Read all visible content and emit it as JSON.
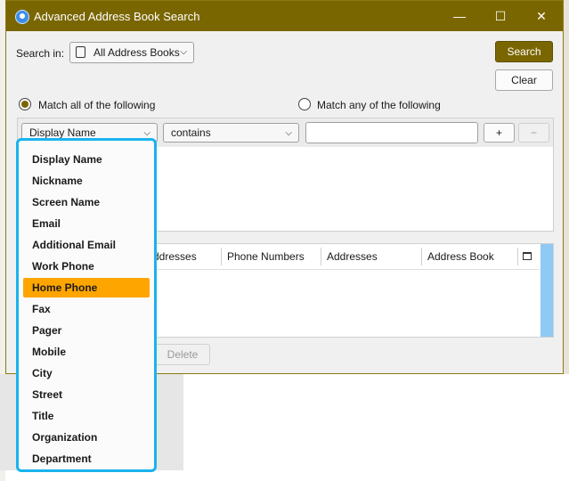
{
  "window": {
    "title": "Advanced Address Book Search",
    "minimize_glyph": "—",
    "maximize_glyph": "☐",
    "close_glyph": "✕"
  },
  "search_in": {
    "label": "Search in:",
    "value": "All Address Books"
  },
  "buttons": {
    "search": "Search",
    "clear": "Clear",
    "delete": "Delete",
    "add_term": "+",
    "remove_term": "−"
  },
  "match": {
    "all": "Match all of the following",
    "any": "Match any of the following"
  },
  "criteria": {
    "field": "Display Name",
    "operator": "contains",
    "value": ""
  },
  "results": {
    "columns": [
      "ddresses",
      "Phone Numbers",
      "Addresses",
      "Address Book"
    ]
  },
  "dropdown": {
    "selected": "Home Phone",
    "items": [
      "Display Name",
      "Nickname",
      "Screen Name",
      "Email",
      "Additional Email",
      "Work Phone",
      "Home Phone",
      "Fax",
      "Pager",
      "Mobile",
      "City",
      "Street",
      "Title",
      "Organization",
      "Department"
    ]
  },
  "colors": {
    "accent": "#7a6600",
    "highlight": "#ffa500",
    "focus_border": "#19b3ee"
  }
}
